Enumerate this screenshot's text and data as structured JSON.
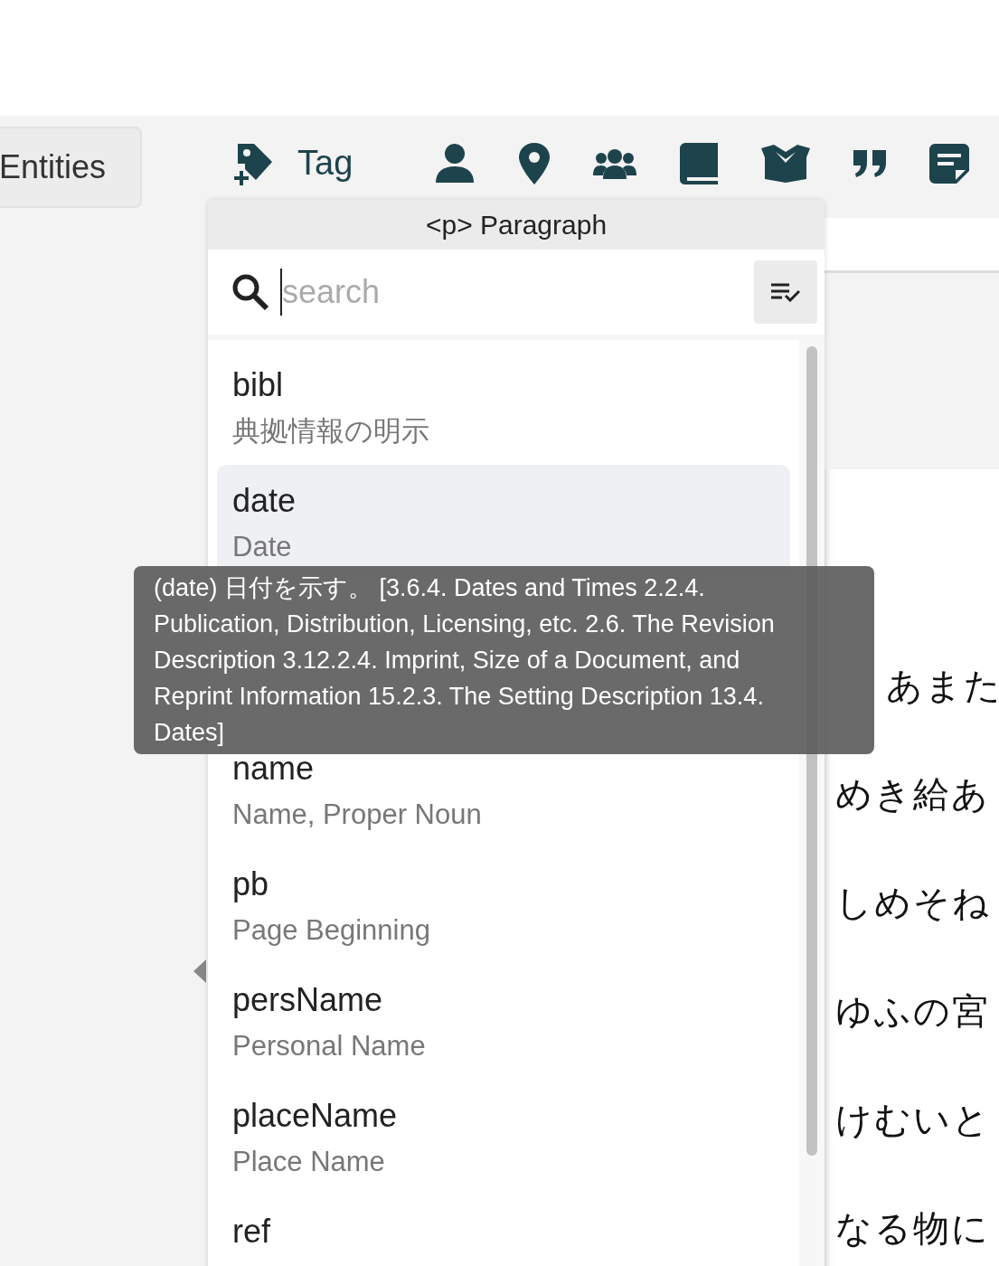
{
  "toolbar": {
    "entities_button": "Entities",
    "tag_button": "Tag"
  },
  "dropdown": {
    "title": "<p> Paragraph",
    "search": {
      "placeholder": "search"
    },
    "items": [
      {
        "name": "bibl",
        "description": "典拠情報の明示",
        "hovered": false
      },
      {
        "name": "date",
        "description": "Date",
        "hovered": true
      },
      {
        "name": "name",
        "description": "Name, Proper Noun",
        "hovered": false
      },
      {
        "name": "pb",
        "description": "Page Beginning",
        "hovered": false
      },
      {
        "name": "persName",
        "description": "Personal Name",
        "hovered": false
      },
      {
        "name": "placeName",
        "description": "Place Name",
        "hovered": false
      },
      {
        "name": "ref",
        "hovered": false
      }
    ]
  },
  "tooltip": "(date) 日付を示す。 [3.6.4. Dates and Times 2.2.4. Publication, Distribution, Licensing, etc. 2.6. The Revision Description 3.12.2.4. Imprint, Size of a Document, and Reprint Information 15.2.3. The Setting Description 13.4. Dates]",
  "text_lines": [
    "あまた",
    "めき給あ",
    "しめそね",
    "ゆふの宮",
    "けむいと",
    "なる物に"
  ]
}
